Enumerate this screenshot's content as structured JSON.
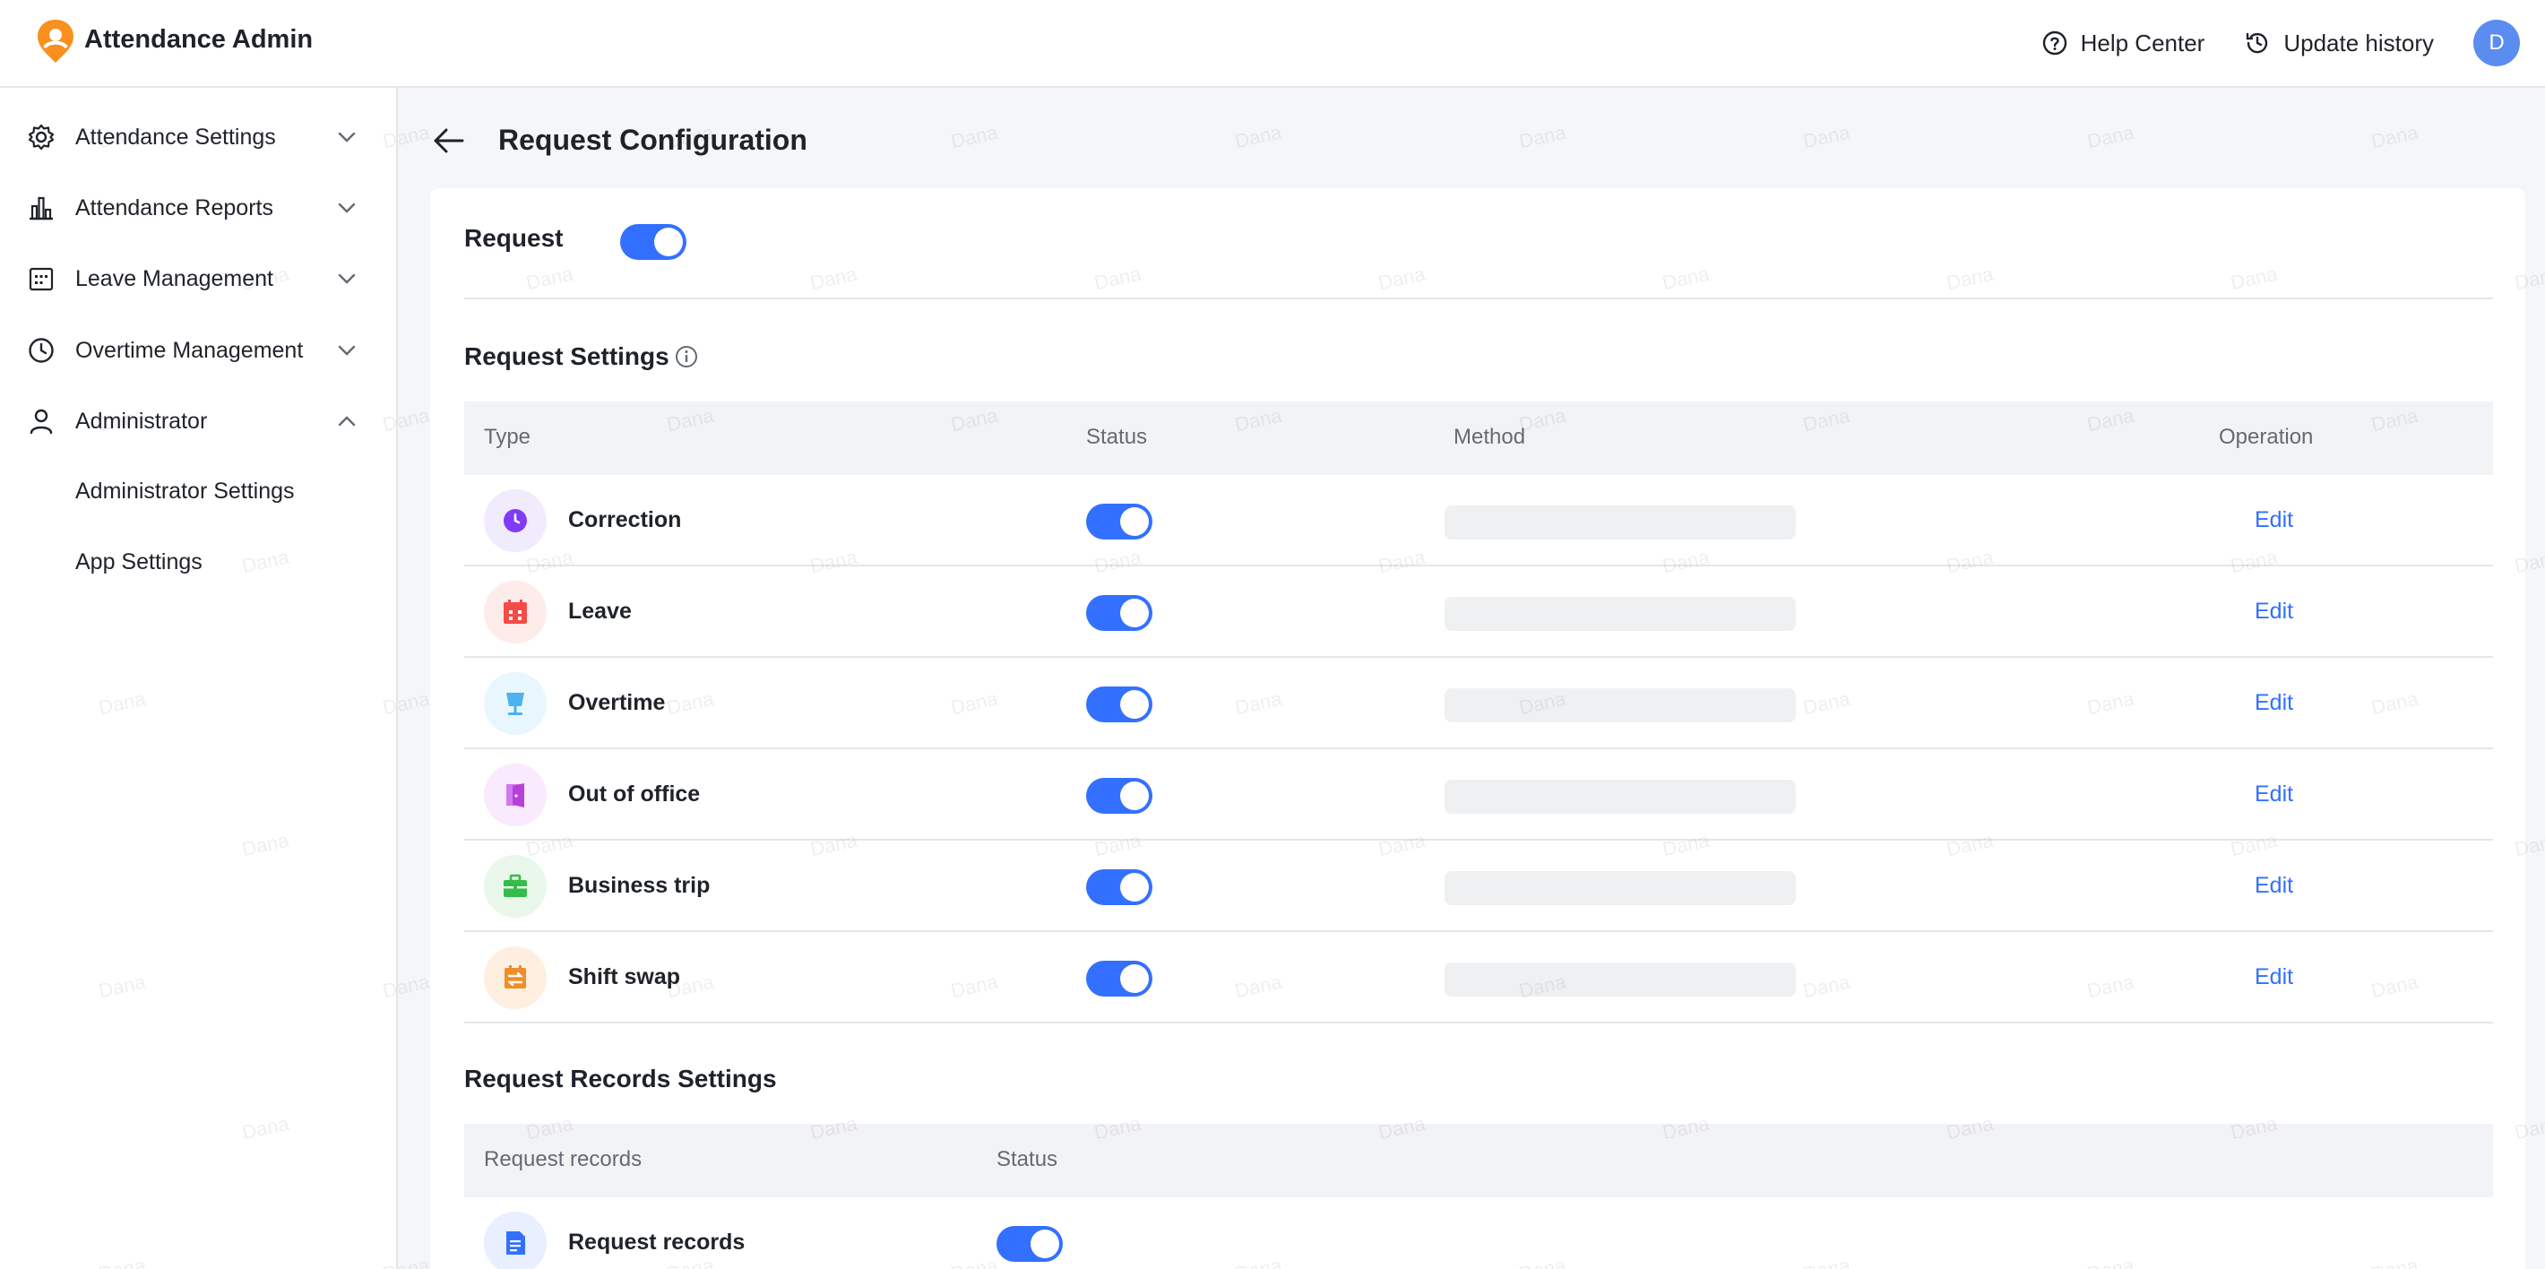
{
  "app": {
    "title": "Attendance Admin",
    "brand_color": "#f7901e"
  },
  "header": {
    "help_label": "Help Center",
    "history_label": "Update history",
    "avatar_initial": "D"
  },
  "sidebar": {
    "items": [
      {
        "label": "Attendance Settings",
        "icon": "gear-icon",
        "expanded": false
      },
      {
        "label": "Attendance Reports",
        "icon": "bar-chart-icon",
        "expanded": false
      },
      {
        "label": "Leave Management",
        "icon": "calendar-icon",
        "expanded": false
      },
      {
        "label": "Overtime Management",
        "icon": "clock-icon",
        "expanded": false
      },
      {
        "label": "Administrator",
        "icon": "user-icon",
        "expanded": true
      }
    ],
    "sub_items": [
      {
        "label": "Administrator Settings"
      },
      {
        "label": "App Settings"
      }
    ]
  },
  "page": {
    "title": "Request Configuration",
    "request_label": "Request",
    "request_enabled": true,
    "request_settings_title": "Request Settings",
    "table": {
      "headers": {
        "type": "Type",
        "status": "Status",
        "method": "Method",
        "operation": "Operation"
      },
      "rows": [
        {
          "name": "Correction",
          "icon": "clock-icon",
          "color": "#7f3bf5",
          "bg": "#f1ebfe",
          "enabled": true,
          "action": "Edit"
        },
        {
          "name": "Leave",
          "icon": "calendar-icon",
          "color": "#f54a45",
          "bg": "#feeceb",
          "enabled": true,
          "action": "Edit"
        },
        {
          "name": "Overtime",
          "icon": "lamp-icon",
          "color": "#4cb3f0",
          "bg": "#e8f6fd",
          "enabled": true,
          "action": "Edit"
        },
        {
          "name": "Out of office",
          "icon": "door-icon",
          "color": "#b840d9",
          "bg": "#f9eafd",
          "enabled": true,
          "action": "Edit"
        },
        {
          "name": "Business trip",
          "icon": "briefcase-icon",
          "color": "#35bd4b",
          "bg": "#e9f8eb",
          "enabled": true,
          "action": "Edit"
        },
        {
          "name": "Shift swap",
          "icon": "swap-icon",
          "color": "#f28d28",
          "bg": "#feefe0",
          "enabled": true,
          "action": "Edit"
        }
      ]
    },
    "records_title": "Request Records Settings",
    "records_table": {
      "headers": {
        "records": "Request records",
        "status": "Status"
      },
      "rows": [
        {
          "name": "Request records",
          "icon": "document-icon",
          "color": "#3370ff",
          "bg": "#e8effe",
          "enabled": true
        }
      ]
    },
    "watermark_text": "Dana"
  },
  "accent_color": "#3370ff"
}
